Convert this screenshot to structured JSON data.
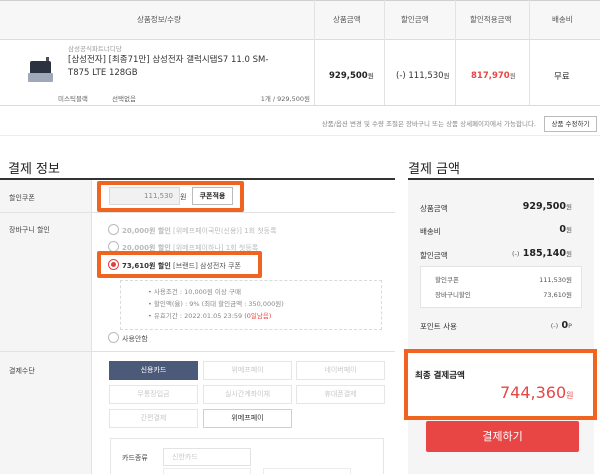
{
  "order_table": {
    "headers": [
      "상품정보/수량",
      "상품금액",
      "할인금액",
      "할인적용금액",
      "배송비"
    ],
    "item": {
      "seller": "삼성공식파트너디당",
      "name": "[삼성전자] [최종71만] 삼성전자 갤럭시탭S7 11.0 SM-T875 LTE 128GB",
      "option_color": "미스틱블랙",
      "option_extra": "선택없음",
      "quantity_price": "1개 / 929,500원",
      "price": "929,500",
      "discount": "(-) 111,530",
      "discounted_price": "817,970",
      "currency_unit": "원",
      "shipping": "무료"
    },
    "notice": "상품/옵션 변경 및 수량 조절은 장바구니 또는 상품 상세페이지에서 가능합니다.",
    "edit_button": "상품 수정하기"
  },
  "payment_info": {
    "title": "결제 정보",
    "coupon_label": "할인쿠폰",
    "coupon_value": "111,530",
    "coupon_unit": "원",
    "coupon_button": "쿠폰적용",
    "cart_discount_label": "장바구니 할인",
    "cart_options": [
      {
        "amount": "20,000원 할인",
        "desc": "[위메프페이국민(신용)] 1회 첫등록",
        "selected": false
      },
      {
        "amount": "20,000원 할인",
        "desc": "[위메프페이하나] 1회 첫등록",
        "selected": false
      },
      {
        "amount": "73,610원 할인",
        "desc": "[브랜드] 삼성전자 쿠폰",
        "selected": true
      }
    ],
    "conditions": {
      "line1": "• 사용조건 : 10,000원 이상 구매",
      "line2": "• 할인액(율) : 9% (최대 할인금액 : 350,000원)",
      "line3": "• 유효기간 : 2022.01.05 23:59 ",
      "line3_red": "(0일남음)"
    },
    "no_use_label": "사용안함",
    "payment_method_label": "결제수단",
    "methods": [
      "신용카드",
      "위메프페이",
      "네이버페이",
      "무통장입금",
      "실시간계좌이체",
      "휴대폰결제",
      "간편결제",
      "위메프페이"
    ],
    "card_type_label": "카드종류",
    "card_type_value": "신한카드"
  },
  "payment_amount": {
    "title": "결제 금액",
    "product_amount_label": "상품금액",
    "product_amount": "929,500",
    "shipping_label": "배송비",
    "shipping": "0",
    "discount_label": "할인금액",
    "discount": "185,140",
    "discount_sign": "(-)",
    "sub": [
      {
        "label": "할인쿠폰",
        "value": "111,530원"
      },
      {
        "label": "장바구니할인",
        "value": "73,610원"
      }
    ],
    "points_label": "포인트 사용",
    "points_sign": "(-)",
    "points": "0",
    "points_unit": "P",
    "unit": "원",
    "final_label": "최종 결제금액",
    "final_amount": "744,360",
    "pay_button": "결제하기"
  },
  "colors": {
    "highlight": "#f06420",
    "accent_red": "#e84545",
    "method_selected": "#4c5a7a"
  }
}
